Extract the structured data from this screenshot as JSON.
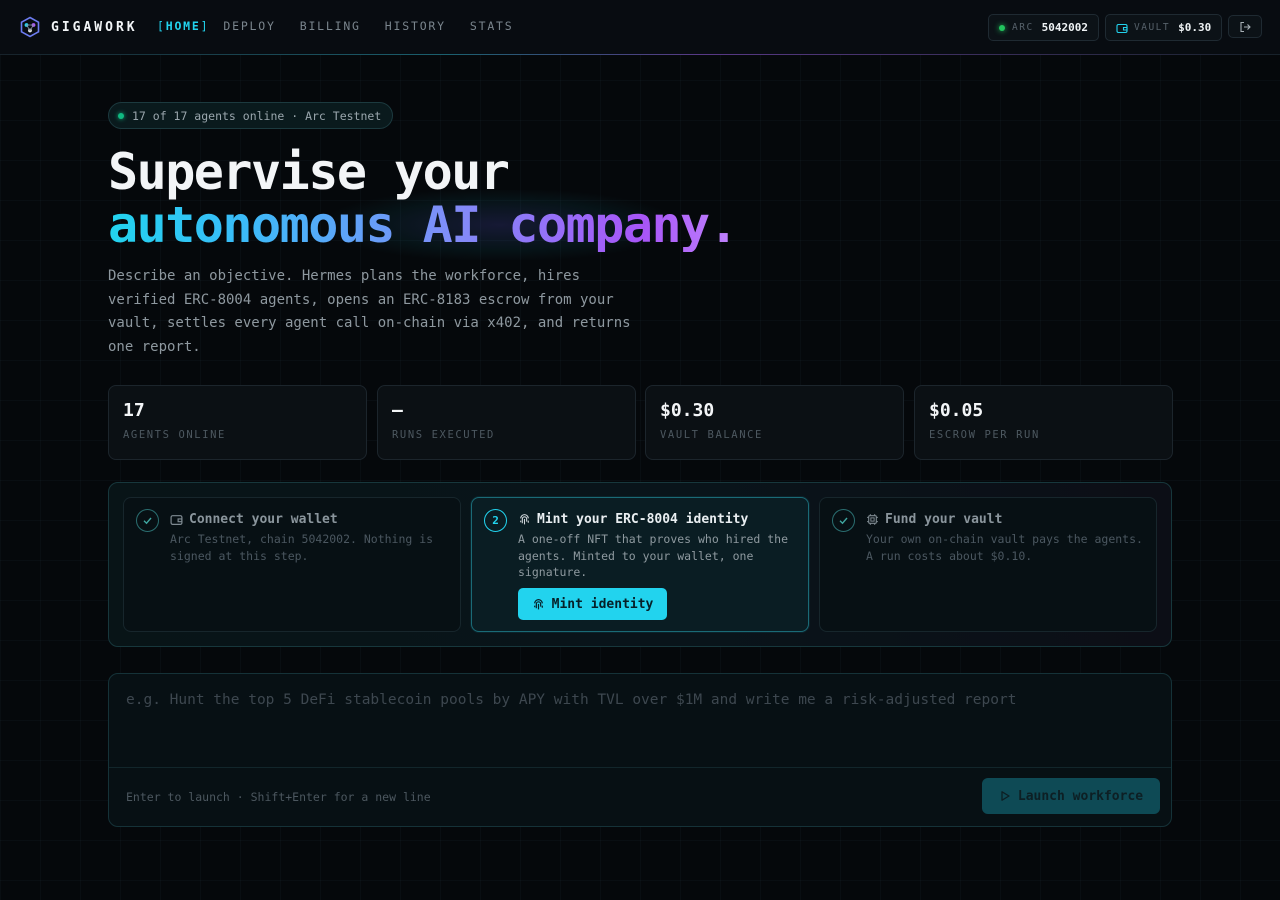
{
  "brand": {
    "name": "GIGAWORK"
  },
  "nav": {
    "bracket_open": "[",
    "bracket_close": "]",
    "items": [
      {
        "label": "HOME",
        "active": true
      },
      {
        "label": "DEPLOY"
      },
      {
        "label": "BILLING"
      },
      {
        "label": "HISTORY"
      },
      {
        "label": "STATS"
      }
    ]
  },
  "header": {
    "network": {
      "label": "ARC",
      "value": "5042002"
    },
    "vault": {
      "label": "VAULT",
      "value": "$0.30"
    },
    "icons": {
      "vault": "wallet-icon",
      "logout": "logout-icon"
    }
  },
  "hero": {
    "status": "17 of 17 agents online · Arc Testnet",
    "headline_line1": "Supervise your",
    "headline_line2": "autonomous AI company.",
    "description": "Describe an objective. Hermes plans the workforce, hires verified ERC-8004 agents, opens an ERC-8183 escrow from your vault, settles every agent call on-chain via x402, and returns one report."
  },
  "stats": [
    {
      "value": "17",
      "label": "AGENTS ONLINE"
    },
    {
      "value": "—",
      "label": "RUNS EXECUTED"
    },
    {
      "value": "$0.30",
      "label": "VAULT BALANCE"
    },
    {
      "value": "$0.05",
      "label": "ESCROW PER RUN"
    }
  ],
  "steps": [
    {
      "number": "",
      "state": "done",
      "icon": "wallet-icon",
      "title": "Connect your wallet",
      "body": "Arc Testnet, chain 5042002. Nothing is signed at this step."
    },
    {
      "number": "2",
      "state": "active",
      "icon": "fingerprint-icon",
      "title": "Mint your ERC-8004 identity",
      "body": "A one-off NFT that proves who hired the agents. Minted to your wallet, one signature.",
      "button": "Mint identity"
    },
    {
      "number": "",
      "state": "done",
      "icon": "chip-icon",
      "title": "Fund your vault",
      "body": "Your own on-chain vault pays the agents. A run costs about $0.10."
    }
  ],
  "composer": {
    "placeholder": "e.g. Hunt the top 5 DeFi stablecoin pools by APY with TVL over $1M and write me a risk-adjusted report",
    "value": "",
    "hint": "Enter to launch · Shift+Enter for a new line",
    "button": "Launch workforce"
  },
  "colors": {
    "accent": "#22d3ee",
    "accent_purple": "#a855f7",
    "online": "#22c55e",
    "background": "#05080b"
  }
}
